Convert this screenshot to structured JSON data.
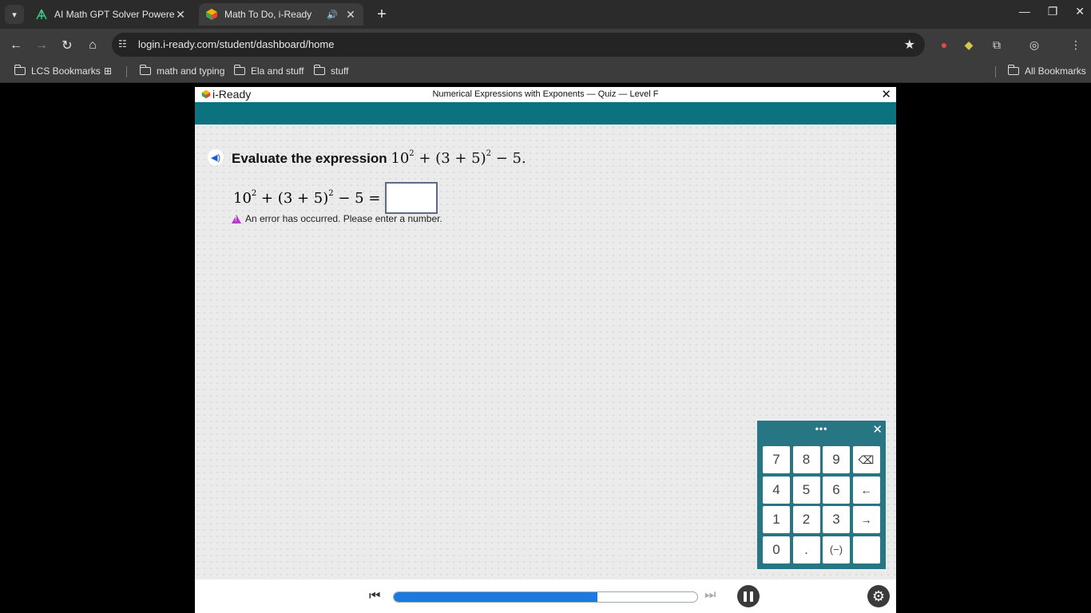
{
  "browser": {
    "tabs": [
      {
        "title": "AI Math GPT Solver Powered b",
        "active": false
      },
      {
        "title": "Math To Do, i-Ready",
        "active": true
      }
    ],
    "url": "login.i-ready.com/student/dashboard/home",
    "bookmarks": [
      "LCS Bookmarks",
      "math and typing",
      "Ela and stuff",
      "stuff"
    ],
    "all_bookmarks": "All Bookmarks"
  },
  "iready": {
    "logo": "i-Ready",
    "header_title": "Numerical Expressions with Exponents — Quiz — Level F",
    "prompt_label": "Evaluate the expression",
    "expression": {
      "base": "10",
      "exp": "2",
      "mid": " + (3 + 5)",
      "exp2": "2",
      "tail": " − 5",
      "period": "."
    },
    "equation": {
      "base": "10",
      "exp": "2",
      "mid": " + (3 + 5)",
      "exp2": "2",
      "tail": " − 5 = "
    },
    "answer_value": "",
    "error_message": "An error has occurred. Please enter a number.",
    "keypad": {
      "menu": "•••",
      "keys": [
        "7",
        "8",
        "9",
        "⌫",
        "4",
        "5",
        "6",
        "←",
        "1",
        "2",
        "3",
        "→",
        "0",
        ".",
        "(−)",
        ""
      ]
    },
    "progress_fraction": 0.67
  },
  "colors": {
    "accent_band": "#0b7280",
    "keypad_bg": "#267683",
    "progress_fill": "#1b79df",
    "error_icon": "#b13ac7"
  }
}
